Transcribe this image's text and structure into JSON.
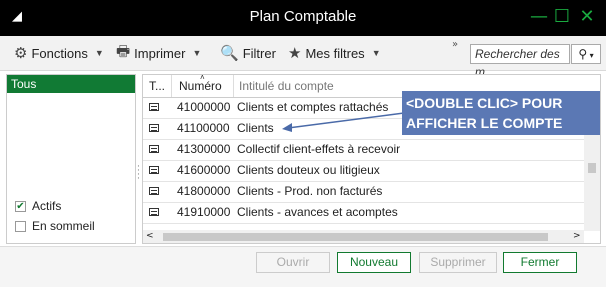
{
  "window": {
    "title": "Plan Comptable",
    "minimize": "—",
    "maximize": "☐",
    "close": "✕",
    "app_icon": "◢"
  },
  "toolbar": {
    "fonctions": "Fonctions",
    "imprimer": "Imprimer",
    "filtrer": "Filtrer",
    "mes_filtres": "Mes filtres",
    "overflow": "»",
    "search_placeholder": "Rechercher des m",
    "search_icon": "⚲"
  },
  "left_panel": {
    "selected": "Tous",
    "checks": [
      {
        "label": "Actifs",
        "checked": true
      },
      {
        "label": "En sommeil",
        "checked": false
      }
    ]
  },
  "grid": {
    "columns": [
      "T...",
      "Numéro",
      "Intitulé du compte"
    ],
    "rows": [
      {
        "num": "41000000",
        "label": "Clients et comptes rattachés"
      },
      {
        "num": "41100000",
        "label": "Clients"
      },
      {
        "num": "41300000",
        "label": "Collectif client-effets à recevoir"
      },
      {
        "num": "41600000",
        "label": "Clients douteux ou litigieux"
      },
      {
        "num": "41800000",
        "label": "Clients - Prod. non facturés"
      },
      {
        "num": "41910000",
        "label": "Clients - avances et acomptes"
      }
    ]
  },
  "annotation": {
    "line1": "<DOUBLE CLIC> POUR",
    "line2": "AFFICHER LE COMPTE"
  },
  "buttons": {
    "ouvrir": "Ouvrir",
    "nouveau": "Nouveau",
    "supprimer": "Supprimer",
    "fermer": "Fermer"
  }
}
